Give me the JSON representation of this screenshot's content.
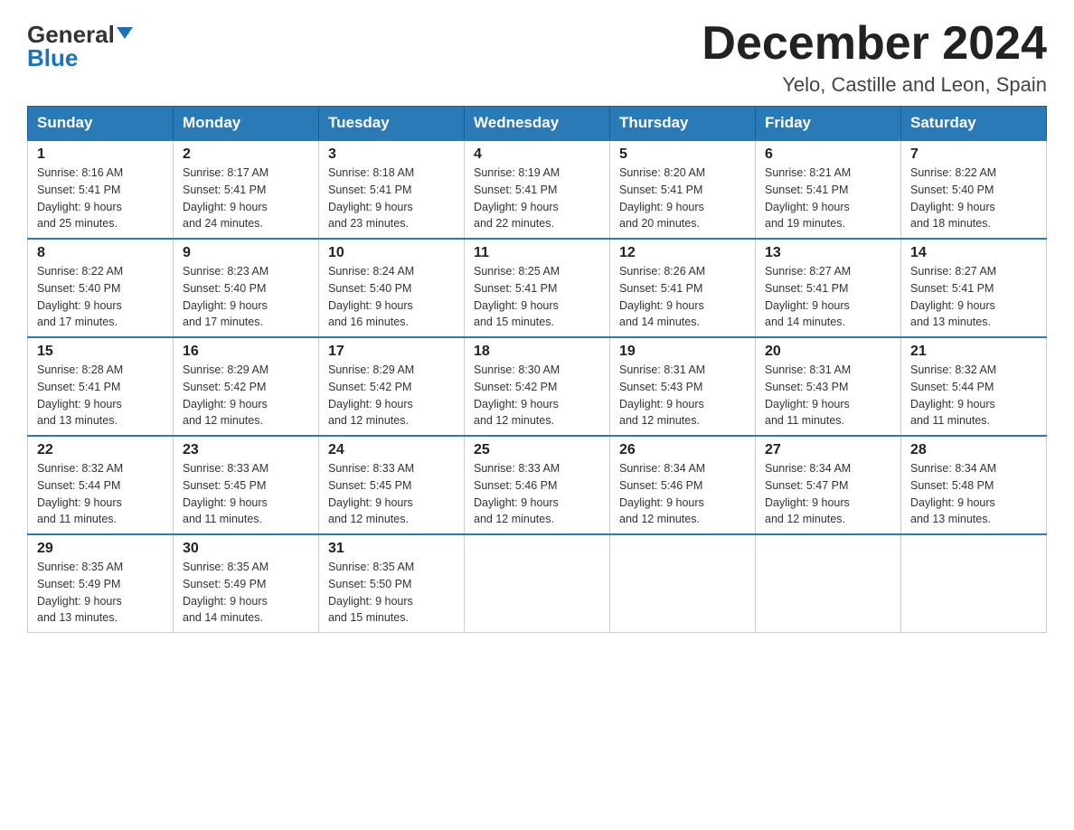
{
  "logo": {
    "general": "General",
    "blue": "Blue",
    "triangle": "▼"
  },
  "title": "December 2024",
  "subtitle": "Yelo, Castille and Leon, Spain",
  "weekdays": [
    "Sunday",
    "Monday",
    "Tuesday",
    "Wednesday",
    "Thursday",
    "Friday",
    "Saturday"
  ],
  "weeks": [
    [
      {
        "day": "1",
        "sunrise": "8:16 AM",
        "sunset": "5:41 PM",
        "daylight": "9 hours and 25 minutes."
      },
      {
        "day": "2",
        "sunrise": "8:17 AM",
        "sunset": "5:41 PM",
        "daylight": "9 hours and 24 minutes."
      },
      {
        "day": "3",
        "sunrise": "8:18 AM",
        "sunset": "5:41 PM",
        "daylight": "9 hours and 23 minutes."
      },
      {
        "day": "4",
        "sunrise": "8:19 AM",
        "sunset": "5:41 PM",
        "daylight": "9 hours and 22 minutes."
      },
      {
        "day": "5",
        "sunrise": "8:20 AM",
        "sunset": "5:41 PM",
        "daylight": "9 hours and 20 minutes."
      },
      {
        "day": "6",
        "sunrise": "8:21 AM",
        "sunset": "5:41 PM",
        "daylight": "9 hours and 19 minutes."
      },
      {
        "day": "7",
        "sunrise": "8:22 AM",
        "sunset": "5:40 PM",
        "daylight": "9 hours and 18 minutes."
      }
    ],
    [
      {
        "day": "8",
        "sunrise": "8:22 AM",
        "sunset": "5:40 PM",
        "daylight": "9 hours and 17 minutes."
      },
      {
        "day": "9",
        "sunrise": "8:23 AM",
        "sunset": "5:40 PM",
        "daylight": "9 hours and 17 minutes."
      },
      {
        "day": "10",
        "sunrise": "8:24 AM",
        "sunset": "5:40 PM",
        "daylight": "9 hours and 16 minutes."
      },
      {
        "day": "11",
        "sunrise": "8:25 AM",
        "sunset": "5:41 PM",
        "daylight": "9 hours and 15 minutes."
      },
      {
        "day": "12",
        "sunrise": "8:26 AM",
        "sunset": "5:41 PM",
        "daylight": "9 hours and 14 minutes."
      },
      {
        "day": "13",
        "sunrise": "8:27 AM",
        "sunset": "5:41 PM",
        "daylight": "9 hours and 14 minutes."
      },
      {
        "day": "14",
        "sunrise": "8:27 AM",
        "sunset": "5:41 PM",
        "daylight": "9 hours and 13 minutes."
      }
    ],
    [
      {
        "day": "15",
        "sunrise": "8:28 AM",
        "sunset": "5:41 PM",
        "daylight": "9 hours and 13 minutes."
      },
      {
        "day": "16",
        "sunrise": "8:29 AM",
        "sunset": "5:42 PM",
        "daylight": "9 hours and 12 minutes."
      },
      {
        "day": "17",
        "sunrise": "8:29 AM",
        "sunset": "5:42 PM",
        "daylight": "9 hours and 12 minutes."
      },
      {
        "day": "18",
        "sunrise": "8:30 AM",
        "sunset": "5:42 PM",
        "daylight": "9 hours and 12 minutes."
      },
      {
        "day": "19",
        "sunrise": "8:31 AM",
        "sunset": "5:43 PM",
        "daylight": "9 hours and 12 minutes."
      },
      {
        "day": "20",
        "sunrise": "8:31 AM",
        "sunset": "5:43 PM",
        "daylight": "9 hours and 11 minutes."
      },
      {
        "day": "21",
        "sunrise": "8:32 AM",
        "sunset": "5:44 PM",
        "daylight": "9 hours and 11 minutes."
      }
    ],
    [
      {
        "day": "22",
        "sunrise": "8:32 AM",
        "sunset": "5:44 PM",
        "daylight": "9 hours and 11 minutes."
      },
      {
        "day": "23",
        "sunrise": "8:33 AM",
        "sunset": "5:45 PM",
        "daylight": "9 hours and 11 minutes."
      },
      {
        "day": "24",
        "sunrise": "8:33 AM",
        "sunset": "5:45 PM",
        "daylight": "9 hours and 12 minutes."
      },
      {
        "day": "25",
        "sunrise": "8:33 AM",
        "sunset": "5:46 PM",
        "daylight": "9 hours and 12 minutes."
      },
      {
        "day": "26",
        "sunrise": "8:34 AM",
        "sunset": "5:46 PM",
        "daylight": "9 hours and 12 minutes."
      },
      {
        "day": "27",
        "sunrise": "8:34 AM",
        "sunset": "5:47 PM",
        "daylight": "9 hours and 12 minutes."
      },
      {
        "day": "28",
        "sunrise": "8:34 AM",
        "sunset": "5:48 PM",
        "daylight": "9 hours and 13 minutes."
      }
    ],
    [
      {
        "day": "29",
        "sunrise": "8:35 AM",
        "sunset": "5:49 PM",
        "daylight": "9 hours and 13 minutes."
      },
      {
        "day": "30",
        "sunrise": "8:35 AM",
        "sunset": "5:49 PM",
        "daylight": "9 hours and 14 minutes."
      },
      {
        "day": "31",
        "sunrise": "8:35 AM",
        "sunset": "5:50 PM",
        "daylight": "9 hours and 15 minutes."
      },
      null,
      null,
      null,
      null
    ]
  ],
  "labels": {
    "sunrise": "Sunrise:",
    "sunset": "Sunset:",
    "daylight": "Daylight:"
  }
}
